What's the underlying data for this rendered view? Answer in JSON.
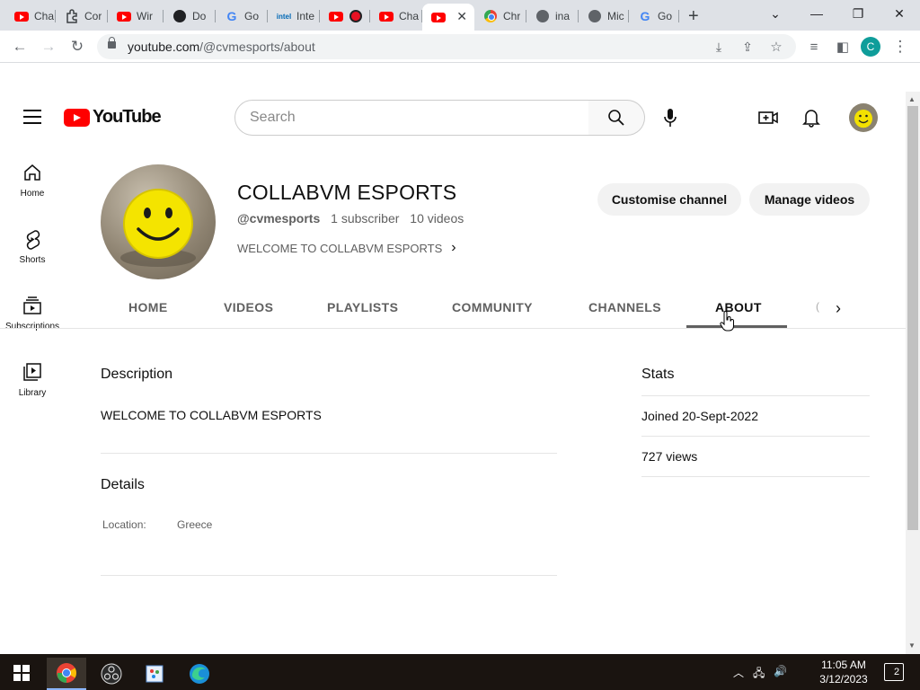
{
  "browser": {
    "tabs": [
      {
        "label": "Cha",
        "icon": "youtube-icon"
      },
      {
        "label": "Cor",
        "icon": "extension-icon"
      },
      {
        "label": "Wir",
        "icon": "youtube-icon"
      },
      {
        "label": "Do",
        "icon": "black-circle-icon"
      },
      {
        "label": "Go",
        "icon": "google-icon"
      },
      {
        "label": "Inte",
        "icon": "intel-icon"
      },
      {
        "label": "",
        "icon": "youtube-icon"
      },
      {
        "label": "Cha",
        "icon": "youtube-icon"
      },
      {
        "label": "",
        "icon": "youtube-icon"
      },
      {
        "label": "Chr",
        "icon": "chrome-icon"
      },
      {
        "label": "ina",
        "icon": "globe-icon"
      },
      {
        "label": "Mic",
        "icon": "globe-icon"
      },
      {
        "label": "Go",
        "icon": "google-icon"
      }
    ],
    "intel_text": "intel",
    "url_host": "youtube.com",
    "url_path": "/@cvmesports/about",
    "profile_initial": "C"
  },
  "youtube": {
    "logo_text": "YouTube",
    "search_placeholder": "Search",
    "guide": [
      {
        "label": "Home",
        "icon": "home-icon"
      },
      {
        "label": "Shorts",
        "icon": "shorts-icon"
      },
      {
        "label": "Subscriptions",
        "icon": "subscriptions-icon"
      },
      {
        "label": "Library",
        "icon": "library-icon"
      }
    ]
  },
  "channel": {
    "title": "COLLABVM ESPORTS",
    "handle": "@cvmesports",
    "subscribers": "1 subscriber",
    "videos": "10 videos",
    "short_description": "WELCOME TO COLLABVM ESPORTS",
    "customise_label": "Customise channel",
    "manage_label": "Manage videos",
    "tabs": [
      "HOME",
      "VIDEOS",
      "PLAYLISTS",
      "COMMUNITY",
      "CHANNELS",
      "ABOUT"
    ],
    "active_tab": "ABOUT"
  },
  "about": {
    "description_heading": "Description",
    "description_text": "WELCOME TO COLLABVM ESPORTS",
    "details_heading": "Details",
    "location_label": "Location:",
    "location_value": "Greece",
    "stats_heading": "Stats",
    "joined": "Joined 20-Sept-2022",
    "views": "727 views"
  },
  "taskbar": {
    "time": "11:05 AM",
    "date": "3/12/2023",
    "notification_count": "2"
  }
}
